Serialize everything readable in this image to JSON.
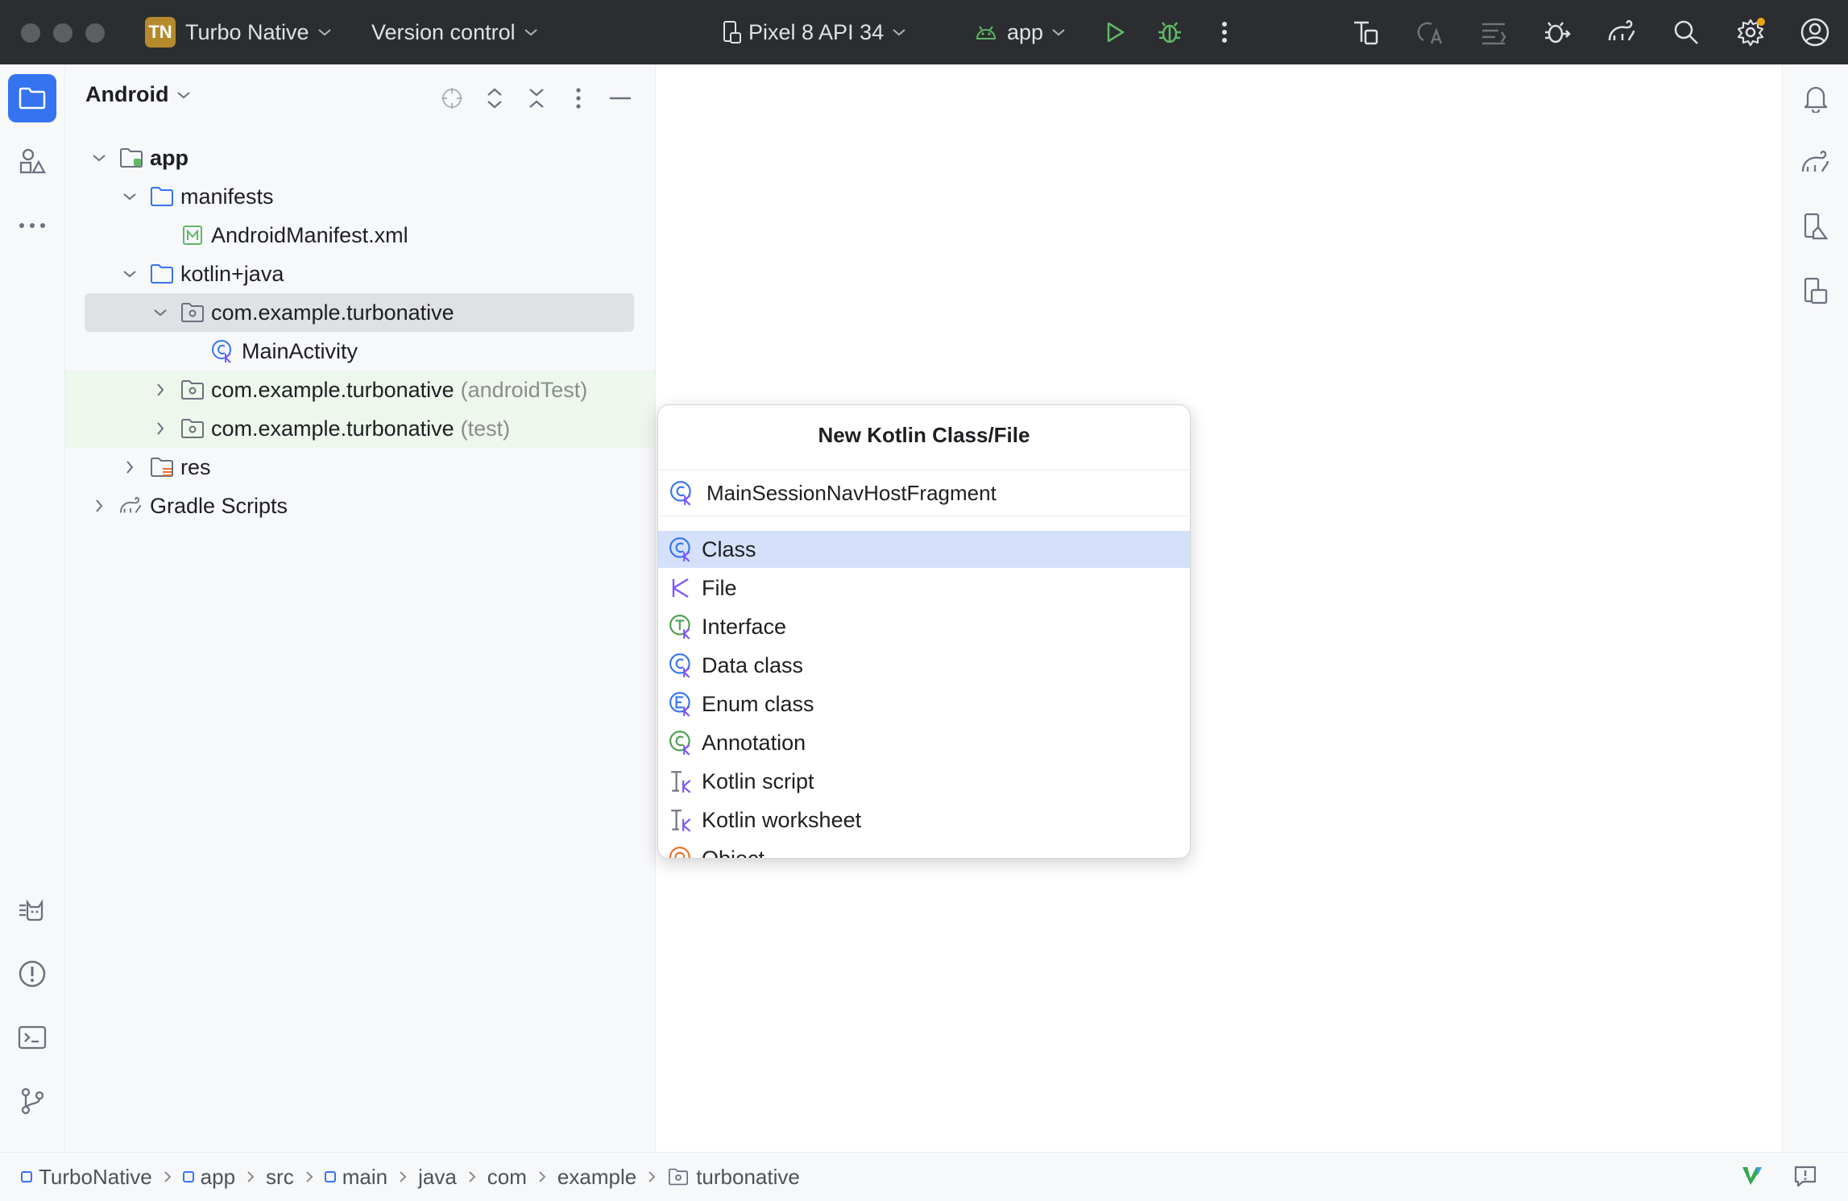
{
  "titlebar": {
    "project_badge": "TN",
    "project_name": "Turbo Native",
    "vcs_label": "Version control",
    "device": "Pixel 8 API 34",
    "run_config": "app"
  },
  "project_panel": {
    "view_mode": "Android",
    "tree": [
      {
        "label": "app",
        "bold": true
      },
      {
        "label": "manifests"
      },
      {
        "label": "AndroidManifest.xml"
      },
      {
        "label": "kotlin+java"
      },
      {
        "label": "com.example.turbonative"
      },
      {
        "label": "MainActivity"
      },
      {
        "label": "com.example.turbonative",
        "suffix": "(androidTest)"
      },
      {
        "label": "com.example.turbonative",
        "suffix": "(test)"
      },
      {
        "label": "res"
      },
      {
        "label": "Gradle Scripts"
      }
    ]
  },
  "popup": {
    "title": "New Kotlin Class/File",
    "input_value": "MainSessionNavHostFragment",
    "items": [
      {
        "label": "Class",
        "icon": "kotlin-class-icon",
        "selected": true
      },
      {
        "label": "File",
        "icon": "kotlin-file-icon"
      },
      {
        "label": "Interface",
        "icon": "kotlin-interface-icon"
      },
      {
        "label": "Data class",
        "icon": "kotlin-data-class-icon"
      },
      {
        "label": "Enum class",
        "icon": "kotlin-enum-icon"
      },
      {
        "label": "Annotation",
        "icon": "kotlin-annotation-icon"
      },
      {
        "label": "Kotlin script",
        "icon": "kotlin-script-icon"
      },
      {
        "label": "Kotlin worksheet",
        "icon": "kotlin-worksheet-icon"
      },
      {
        "label": "Object",
        "icon": "kotlin-object-icon"
      }
    ]
  },
  "statusbar": {
    "breadcrumbs": [
      "TurboNative",
      "app",
      "src",
      "main",
      "java",
      "com",
      "example",
      "turbonative"
    ]
  },
  "colors": {
    "accent": "#3574f0",
    "titlebar_bg": "#2b2d30",
    "selection": "#d5e1fb",
    "test_bg": "#edf7ec",
    "run_green": "#5fb865",
    "kotlin_purple": "#7f52ff"
  }
}
